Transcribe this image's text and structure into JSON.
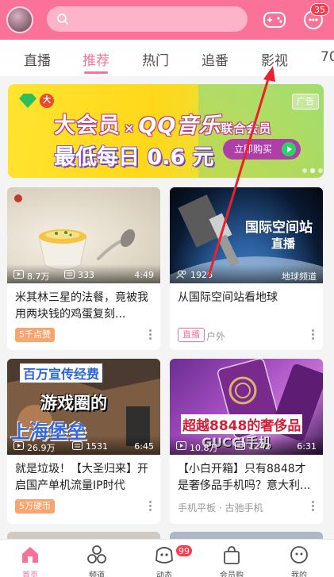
{
  "header": {
    "message_badge": "35"
  },
  "tabs": [
    {
      "label": "直播"
    },
    {
      "label": "推荐"
    },
    {
      "label": "热门"
    },
    {
      "label": "追番"
    },
    {
      "label": "影视"
    },
    {
      "label": "70"
    }
  ],
  "banner": {
    "tag": "大",
    "line1_a": "大会员",
    "line1_x": "×",
    "line1_b": "QQ音乐",
    "line1_c": "联合会员",
    "line2": "最低每日 0.6 元",
    "buy_label": "立即购买",
    "ad_label": "广告"
  },
  "cards": [
    {
      "views": "8.7万",
      "comments": "333",
      "duration": "4:49",
      "title": "米其林三星的法餐，竟被我用两块钱的鸡蛋复刻...",
      "chip": "5千点赞",
      "sub": ""
    },
    {
      "views": "1926",
      "comments": "",
      "duration": "地球频道",
      "title": "从国际空间站看地球",
      "chip": "直播",
      "sub": "户外",
      "thumb_text_1": "国际空间站",
      "thumb_text_2": "直播"
    },
    {
      "views": "26.9万",
      "comments": "1531",
      "duration": "6:45",
      "title": "就是垃圾！【大圣归来】开启国产单机流量IP时代",
      "chip": "5万硬币",
      "sub": "",
      "thumb_text_1": "百万宣传经费",
      "thumb_text_2": "游戏圈的",
      "thumb_text_3": "上海堡垒"
    },
    {
      "views": "10.8万",
      "comments": "1242",
      "duration": "6:31",
      "title": "【小白开箱】只有8848才是奢侈品手机吗？意大利...",
      "chip": "",
      "sub": "手机平板 · 古驰手机",
      "thumb_text_1": "超越8848的奢侈品",
      "thumb_text_2": "GUCCI手机"
    }
  ],
  "bottom_nav": [
    {
      "label": "首页"
    },
    {
      "label": "频道"
    },
    {
      "label": "动态"
    },
    {
      "label": "会员购"
    },
    {
      "label": "我的"
    }
  ],
  "nav_badge": "99",
  "colors": {
    "brand_pink": "#fb7299",
    "annotation_red": "#e8212b"
  }
}
